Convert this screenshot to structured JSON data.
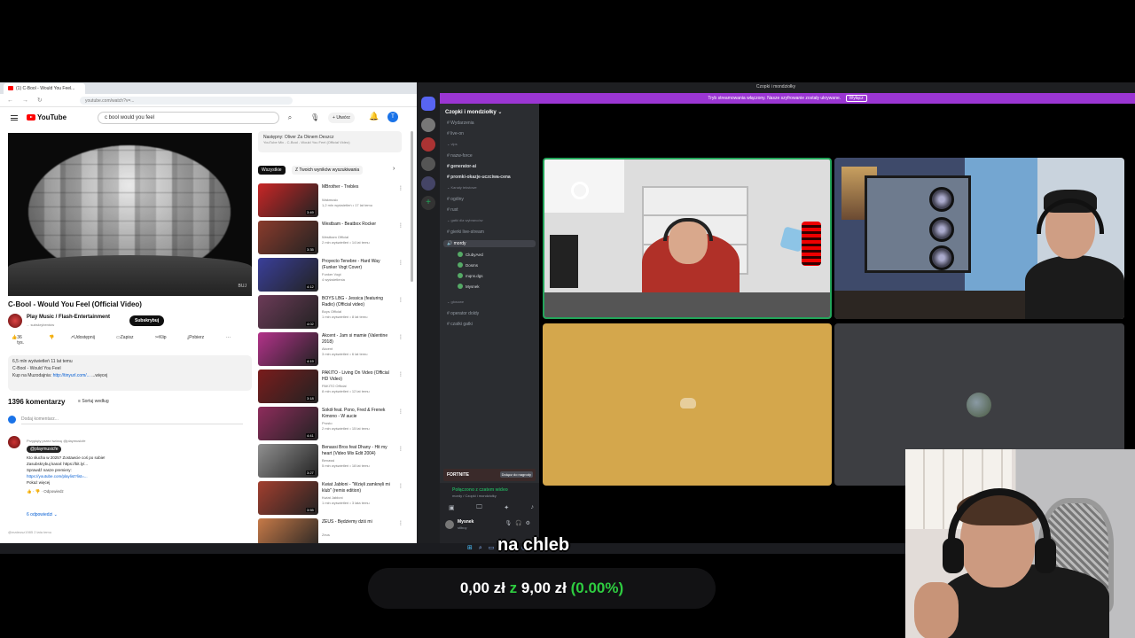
{
  "youtube": {
    "tab_title": "(1) C-Bool - Would You Feel...",
    "url": "youtube.com/watch?v=...",
    "logo_text": "YouTube",
    "search_value": "c bool would you feel",
    "create_label": "Utwórz",
    "notification_count": "9+",
    "avatar_letter": "T",
    "video_watermark": "BUJ",
    "video_title": "C-Bool - Would You Feel (Official Video)",
    "channel_name": "Play Music / Flash-Entertainment",
    "channel_subs": "... subskrybentów",
    "subscribe_label": "Subskrybuj",
    "actions": {
      "likes": "36 tys.",
      "share": "Udostępnij",
      "save": "Zapisz",
      "clip": "Klip",
      "download": "Pobierz"
    },
    "description": {
      "stats": "6,5 mln wyświetleń  11 lat temu",
      "line2": "C-Bool - Would You Feel",
      "buy_label": "Kup na Muzodajnia:",
      "buy_link": "http://tinyurl.com/...",
      "more": "...więcej"
    },
    "comments": {
      "count_label": "1396 komentarzy",
      "sort_label": "Sortuj według",
      "add_placeholder": "Dodaj komentarz...",
      "pinned_by": "Przypięty przez twórcę @playmusicfe",
      "author_badge": "@playmusicfe",
      "line1": "Kto słucha w 2025? Zostawcie coś po sobie!",
      "line2": "Zasubskrybuj kanał: https://bit.ly/...",
      "line3": "Sprawdź nasze premiery:",
      "line4": "https://youtube.com/playlist?list=...",
      "line5": "Pokaż więcej",
      "reply_label": "Odpowiedz",
      "replies_label": "6 odpowiedzi",
      "second_author": "@mateusz1985",
      "second_text": "2 lata temu"
    },
    "up_next": {
      "label": "Następny: Oliver Za Oknem Deszcz",
      "sub": "YouTube Mix - C-Bool - Would You Feel (Official Video)"
    },
    "chips": [
      "Wszystkie",
      "Z Twoich wyników wyszukiwania"
    ],
    "recommendations": [
      {
        "title": "MBrother - Trebles",
        "channel": "Wakmusic",
        "meta": "1,2 mln wyświetleń • 17 lat temu",
        "duration": "3:49",
        "color": "#c82626"
      },
      {
        "title": "Westbam - Beatbox Rocker",
        "channel": "Westbam Official",
        "meta": "2 mln wyświetleń • 14 lat temu",
        "duration": "3:35",
        "color": "#8a3b2c"
      },
      {
        "title": "Proyecto Tenebre - Hard Way (Funker Vogt Cover)",
        "channel": "Funker Vogt",
        "meta": "4 wyświetlenia",
        "duration": "4:12",
        "color": "#3a3f9a"
      },
      {
        "title": "BOYS LBG - Jessica (featuring Radio) (Official video)",
        "channel": "Boys Official",
        "meta": "1 mln wyświetleń • 8 lat temu",
        "duration": "4:02",
        "color": "#6c3b58"
      },
      {
        "title": "Akcent - Jam si mamie (Valentine 2018)",
        "channel": "Akcent",
        "meta": "3 mln wyświetleń • 6 lat temu",
        "duration": "4:19",
        "color": "#b3328a"
      },
      {
        "title": "PAKITO - Living On Video (Official HD Video)",
        "channel": "PAKITO Official",
        "meta": "8 mln wyświetleń • 12 lat temu",
        "duration": "3:18",
        "color": "#7a1c1c"
      },
      {
        "title": "Sokół feat. Pono, Fred & Frenek Kimono - W aucie",
        "channel": "Prosto",
        "meta": "2 mln wyświetleń • 15 lat temu",
        "duration": "4:41",
        "color": "#8e2c5c"
      },
      {
        "title": "Benassi Bros feat Dhany - Hit my heart (Video Mix Edit 2004)",
        "channel": "Benassi",
        "meta": "5 mln wyświetleń • 18 lat temu",
        "duration": "3:27",
        "color": "#909090"
      },
      {
        "title": "Kwiat Jabłoni - \"Wzięli zamknęli mi klub\" (remix edition)",
        "channel": "Kwiat Jabłoni",
        "meta": "1 mln wyświetleń • 3 lata temu",
        "duration": "3:55",
        "color": "#a23f2f"
      },
      {
        "title": "ZEUS - Będziemy dziś mi",
        "channel": "Zeus",
        "meta": "",
        "duration": "4:08",
        "color": "#c77a48"
      }
    ]
  },
  "discord": {
    "window_title": "Czopki i mondziołky",
    "banner_text": "Tryb streamowania włączony. Nasze szyfrowanie zostały ukrywane.",
    "banner_button": "Wyłącz",
    "server_name": "Czopki i mondziołky",
    "channels": [
      {
        "label": "Wydarzenia",
        "type": "item"
      },
      {
        "label": "live-on",
        "type": "item"
      },
      {
        "label": "vips",
        "type": "cat"
      },
      {
        "label": "nazw-force",
        "type": "item"
      },
      {
        "label": "generator-ai",
        "type": "bold"
      },
      {
        "label": "promki-okazje-uczciwa-cena",
        "type": "bold"
      },
      {
        "label": "Kanały tekstowe",
        "type": "cat"
      },
      {
        "label": "ogólny",
        "type": "item"
      },
      {
        "label": "rust",
        "type": "item"
      },
      {
        "label": "gatki dla wybranców",
        "type": "cat"
      },
      {
        "label": "gierki live-stream",
        "type": "item"
      }
    ],
    "active_voice": "mordy",
    "voice_users": [
      "ClubyAecl",
      "Dosms",
      "mqns.dgs",
      "Mysnek"
    ],
    "more_channels": [
      {
        "label": "głosowe",
        "type": "cat"
      },
      {
        "label": "operator doldy",
        "type": "item"
      },
      {
        "label": "czatki gatki",
        "type": "item"
      }
    ],
    "game_banner": "FORTNITE",
    "game_button": "Dołącz do nagrody",
    "voice_status": "Połączono z czatem wideo",
    "voice_sub": "mordy / Czopki i mondziołky",
    "user_name": "Mysnek",
    "user_status": "stlbuy"
  },
  "overlay": {
    "subtitle": "na chleb",
    "goal_current": "0,00 zł",
    "goal_of": "z",
    "goal_target": "9,00 zł",
    "goal_percent": "(0.00%)",
    "goal_progress": 0
  },
  "taskbar": {
    "icons": [
      "windows-icon",
      "search-icon",
      "task-view-icon",
      "edge-icon",
      "explorer-icon",
      "chrome-icon",
      "discord-icon",
      "obs-icon"
    ]
  },
  "colors": {
    "discord_banner": "#9b36d3",
    "speaking_ring": "#23a55a",
    "goal_accent": "#2ecc40",
    "youtube_red": "#ff0000"
  }
}
